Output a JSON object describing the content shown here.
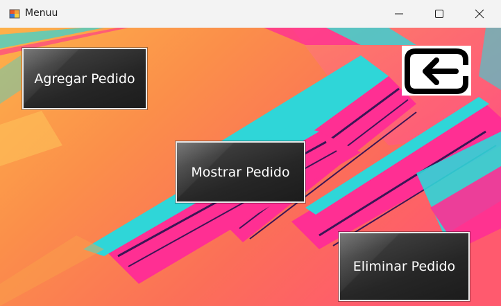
{
  "window": {
    "title": "Menuu",
    "icon": "winforms-app-icon",
    "controls": [
      "minimize-icon",
      "maximize-icon",
      "close-icon"
    ]
  },
  "buttons": {
    "agregar": "Agregar Pedido",
    "mostrar": "Mostrar Pedido",
    "eliminar": "Eliminar Pedido"
  },
  "back_button": {
    "icon": "back-arrow-icon"
  },
  "colors": {
    "orange": "#f98a4c",
    "coral": "#fb6b5e",
    "pink": "#ff2f93",
    "cyan": "#2fd6d8",
    "button_dark": "#262626"
  }
}
